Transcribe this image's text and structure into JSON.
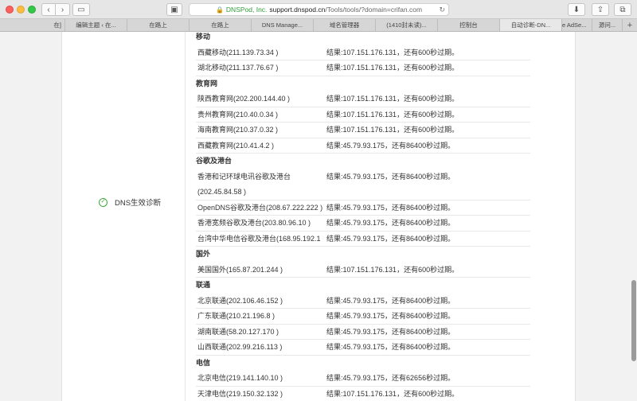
{
  "browser": {
    "site_org": "DNSPod, Inc.",
    "url_host": "support.dnspod.cn",
    "url_path": "/Tools/tools/?domain=crifan.com",
    "tabs": [
      {
        "label": "在]"
      },
      {
        "label": "编辑主题 ‹ 在..."
      },
      {
        "label": "在路上"
      },
      {
        "label": "在路上"
      },
      {
        "label": "DNS Manage..."
      },
      {
        "label": "域名管理器"
      },
      {
        "label": "(1410封未读)..."
      },
      {
        "label": "控制台"
      },
      {
        "label": "自动诊断-DN..."
      },
      {
        "label": "e AdSe..."
      },
      {
        "label": "源问..."
      }
    ]
  },
  "diagnosis": {
    "label": "DNS生效诊断",
    "sections": [
      {
        "title": "移动",
        "rows": [
          {
            "loc": "西藏移动(211.139.73.34 )",
            "res": "结果:107.151.176.131，还有600秒过期。"
          },
          {
            "loc": "湖北移动(211.137.76.67 )",
            "res": "结果:107.151.176.131，还有600秒过期。"
          }
        ]
      },
      {
        "title": "教育网",
        "rows": [
          {
            "loc": "陕西教育网(202.200.144.40 )",
            "res": "结果:107.151.176.131，还有600秒过期。"
          },
          {
            "loc": "贵州教育网(210.40.0.34 )",
            "res": "结果:107.151.176.131，还有600秒过期。"
          },
          {
            "loc": "海南教育网(210.37.0.32 )",
            "res": "结果:107.151.176.131，还有600秒过期。"
          },
          {
            "loc": "西藏教育网(210.41.4.2 )",
            "res": "结果:45.79.93.175，还有86400秒过期。"
          }
        ]
      },
      {
        "title": "谷歌及港台",
        "rows": [
          {
            "loc": "香港和记环球电讯谷歌及港台",
            "loc2": "(202.45.84.58 )",
            "res": "结果:45.79.93.175，还有86400秒过期。"
          },
          {
            "loc": "OpenDNS谷歌及港台(208.67.222.222 )",
            "res": "结果:45.79.93.175，还有86400秒过期。"
          },
          {
            "loc": "香港宽频谷歌及港台(203.80.96.10 )",
            "res": "结果:45.79.93.175，还有86400秒过期。"
          },
          {
            "loc": "台湾中华电信谷歌及港台(168.95.192.1 )",
            "res": "结果:45.79.93.175，还有86400秒过期。"
          }
        ]
      },
      {
        "title": "国外",
        "rows": [
          {
            "loc": "美国国外(165.87.201.244 )",
            "res": "结果:107.151.176.131，还有600秒过期。"
          }
        ]
      },
      {
        "title": "联通",
        "rows": [
          {
            "loc": "北京联通(202.106.46.152 )",
            "res": "结果:45.79.93.175，还有86400秒过期。"
          },
          {
            "loc": "广东联通(210.21.196.8 )",
            "res": "结果:45.79.93.175，还有86400秒过期。"
          },
          {
            "loc": "湖南联通(58.20.127.170 )",
            "res": "结果:45.79.93.175，还有86400秒过期。"
          },
          {
            "loc": "山西联通(202.99.216.113 )",
            "res": "结果:45.79.93.175，还有86400秒过期。"
          }
        ]
      },
      {
        "title": "电信",
        "rows": [
          {
            "loc": "北京电信(219.141.140.10 )",
            "res": "结果:45.79.93.175，还有62656秒过期。"
          },
          {
            "loc": "天津电信(219.150.32.132 )",
            "res": "结果:107.151.176.131，还有600秒过期。"
          }
        ]
      }
    ]
  }
}
